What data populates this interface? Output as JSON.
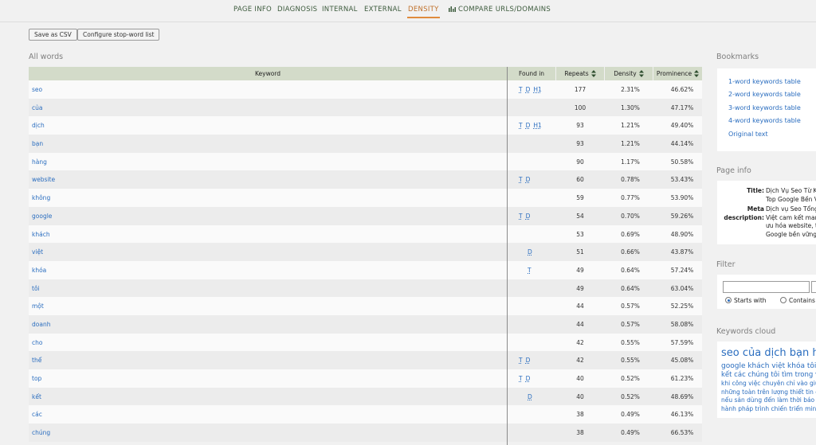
{
  "nav": {
    "tabs": [
      {
        "label": "PAGE INFO"
      },
      {
        "label": "DIAGNOSIS"
      },
      {
        "label": "INTERNAL"
      },
      {
        "label": "EXTERNAL"
      },
      {
        "label": "DENSITY"
      },
      {
        "label": "COMPARE URLS/DOMAINS"
      }
    ],
    "active_tab": "DENSITY",
    "accent_color": "#e08a3c"
  },
  "toolbar": {
    "save_csv_label": "Save as CSV",
    "stopword_label": "Configure stop-word list"
  },
  "all_words": {
    "title": "All words",
    "columns": [
      "Keyword",
      "Found in",
      "Repeats",
      "Density",
      "Prominence"
    ],
    "rows": [
      {
        "keyword": "seo",
        "found_in": [
          "T",
          "D",
          "H1"
        ],
        "repeats": "177",
        "density": "2.31%",
        "prominence": "46.62%"
      },
      {
        "keyword": "của",
        "found_in": [],
        "repeats": "100",
        "density": "1.30%",
        "prominence": "47.17%"
      },
      {
        "keyword": "dịch",
        "found_in": [
          "T",
          "D",
          "H1"
        ],
        "repeats": "93",
        "density": "1.21%",
        "prominence": "49.40%"
      },
      {
        "keyword": "bạn",
        "found_in": [],
        "repeats": "93",
        "density": "1.21%",
        "prominence": "44.14%"
      },
      {
        "keyword": "hàng",
        "found_in": [],
        "repeats": "90",
        "density": "1.17%",
        "prominence": "50.58%"
      },
      {
        "keyword": "website",
        "found_in": [
          "T",
          "D"
        ],
        "repeats": "60",
        "density": "0.78%",
        "prominence": "53.43%"
      },
      {
        "keyword": "không",
        "found_in": [],
        "repeats": "59",
        "density": "0.77%",
        "prominence": "53.90%"
      },
      {
        "keyword": "google",
        "found_in": [
          "T",
          "D"
        ],
        "repeats": "54",
        "density": "0.70%",
        "prominence": "59.26%"
      },
      {
        "keyword": "khách",
        "found_in": [],
        "repeats": "53",
        "density": "0.69%",
        "prominence": "48.90%"
      },
      {
        "keyword": "việt",
        "found_in": [
          "D"
        ],
        "repeats": "51",
        "density": "0.66%",
        "prominence": "43.87%"
      },
      {
        "keyword": "khóa",
        "found_in": [
          "T"
        ],
        "repeats": "49",
        "density": "0.64%",
        "prominence": "57.24%"
      },
      {
        "keyword": "tôi",
        "found_in": [],
        "repeats": "49",
        "density": "0.64%",
        "prominence": "63.04%"
      },
      {
        "keyword": "một",
        "found_in": [],
        "repeats": "44",
        "density": "0.57%",
        "prominence": "52.25%"
      },
      {
        "keyword": "doanh",
        "found_in": [],
        "repeats": "44",
        "density": "0.57%",
        "prominence": "58.08%"
      },
      {
        "keyword": "cho",
        "found_in": [],
        "repeats": "42",
        "density": "0.55%",
        "prominence": "57.59%"
      },
      {
        "keyword": "thể",
        "found_in": [
          "T",
          "D"
        ],
        "repeats": "42",
        "density": "0.55%",
        "prominence": "45.08%"
      },
      {
        "keyword": "top",
        "found_in": [
          "T",
          "D"
        ],
        "repeats": "40",
        "density": "0.52%",
        "prominence": "61.23%"
      },
      {
        "keyword": "kết",
        "found_in": [
          "D"
        ],
        "repeats": "40",
        "density": "0.52%",
        "prominence": "48.69%"
      },
      {
        "keyword": "các",
        "found_in": [],
        "repeats": "38",
        "density": "0.49%",
        "prominence": "46.13%"
      },
      {
        "keyword": "chúng",
        "found_in": [],
        "repeats": "38",
        "density": "0.49%",
        "prominence": "66.53%"
      }
    ]
  },
  "bookmarks": {
    "title": "Bookmarks",
    "links": [
      "1-word keywords table",
      "2-word keywords table",
      "3-word keywords table",
      "4-word keywords table",
      "Original text"
    ]
  },
  "page_info": {
    "title": "Page info",
    "title_label": "Title:",
    "title_lines": [
      "Dịch Vụ Seo Từ K",
      "Top Google Bền V"
    ],
    "meta_label_1": "Meta",
    "meta_label_2": "description:",
    "meta_lines": [
      "Dịch vụ Seo Tổng",
      "Việt cam kết mar",
      "ưu hóa website, t",
      "Google bền vững"
    ]
  },
  "filter": {
    "title": "Filter",
    "starts_with_label": "Starts with",
    "contains_label": "Contains",
    "selected": "Starts with"
  },
  "keywords_cloud": {
    "title": "Keywords cloud",
    "lines": [
      "seo của dịch bạn hàng",
      "google khách việt khóa tôi m",
      "kết các chúng tôi tìm trong với",
      "khi công việc chuyên chỉ vào giúp",
      "những toàn trên lượng thiết tin c",
      "nếu sản dùng đến làm thời báo c",
      "hành pháp trình chiến triển minh"
    ]
  }
}
